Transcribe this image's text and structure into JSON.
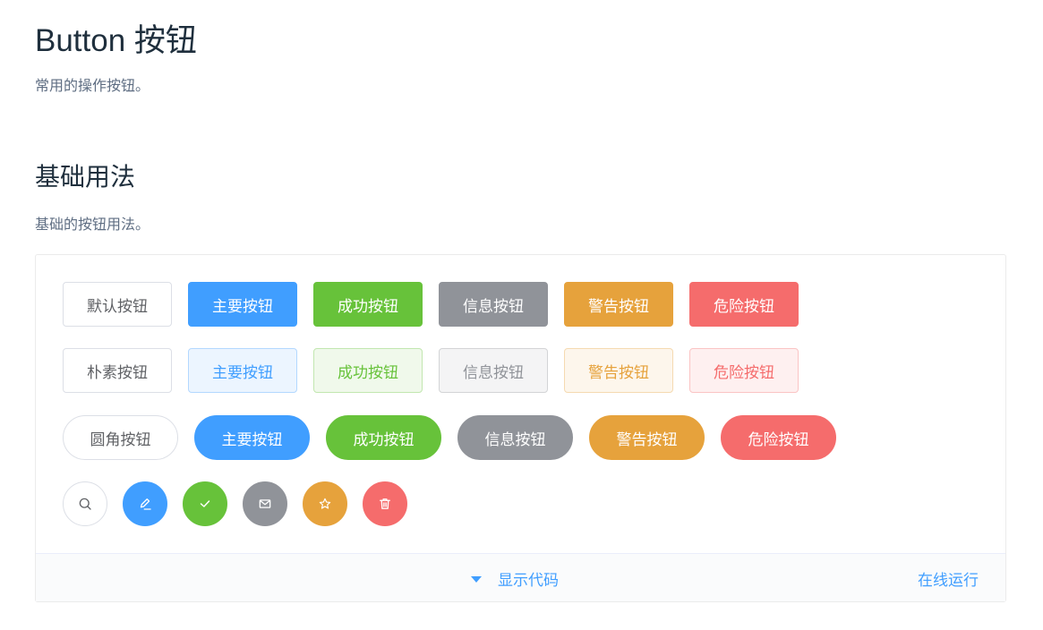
{
  "page": {
    "title": "Button 按钮",
    "description": "常用的操作按钮。"
  },
  "section": {
    "title": "基础用法",
    "description": "基础的按钮用法。"
  },
  "rows": {
    "default": [
      "默认按钮",
      "主要按钮",
      "成功按钮",
      "信息按钮",
      "警告按钮",
      "危险按钮"
    ],
    "plain": [
      "朴素按钮",
      "主要按钮",
      "成功按钮",
      "信息按钮",
      "警告按钮",
      "危险按钮"
    ],
    "round": [
      "圆角按钮",
      "主要按钮",
      "成功按钮",
      "信息按钮",
      "警告按钮",
      "危险按钮"
    ],
    "circle_icons": [
      "search-icon",
      "edit-icon",
      "check-icon",
      "message-icon",
      "star-icon",
      "delete-icon"
    ]
  },
  "footer": {
    "show_code": "显示代码",
    "run_online": "在线运行"
  },
  "colors": {
    "primary": "#409eff",
    "success": "#67c23a",
    "info": "#909399",
    "warning": "#e6a23c",
    "danger": "#f56c6c"
  }
}
